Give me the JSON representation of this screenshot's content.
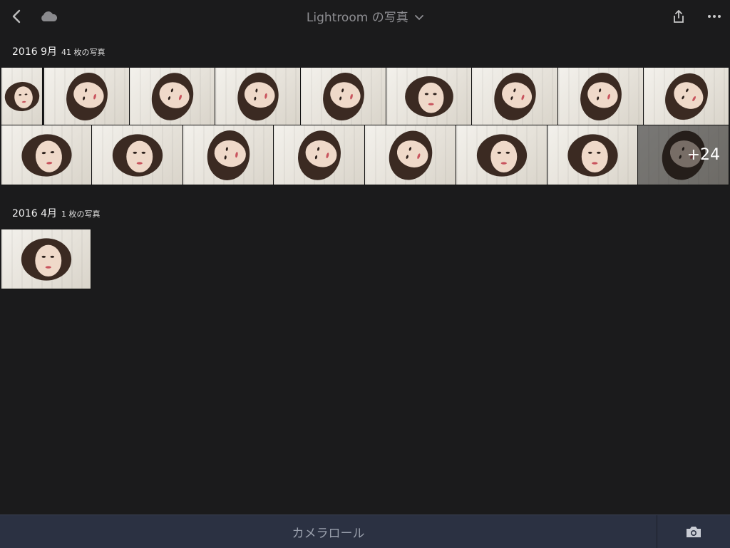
{
  "header": {
    "title": "Lightroom の写真",
    "icons": [
      "back-chevron-icon",
      "cloud-icon",
      "share-icon",
      "more-icon",
      "chevron-down-icon"
    ]
  },
  "sections": [
    {
      "date": "2016 9月",
      "count": "41 枚の写真",
      "more_count": "+24"
    },
    {
      "date": "2016 4月",
      "count": "1 枚の写真"
    }
  ],
  "bottom": {
    "camera_roll_label": "カメラロール",
    "camera_icon": "camera-icon"
  },
  "colors": {
    "background": "#1b1b1c",
    "bottom_bar": "#2b3142",
    "title_text": "#8e8e92"
  }
}
